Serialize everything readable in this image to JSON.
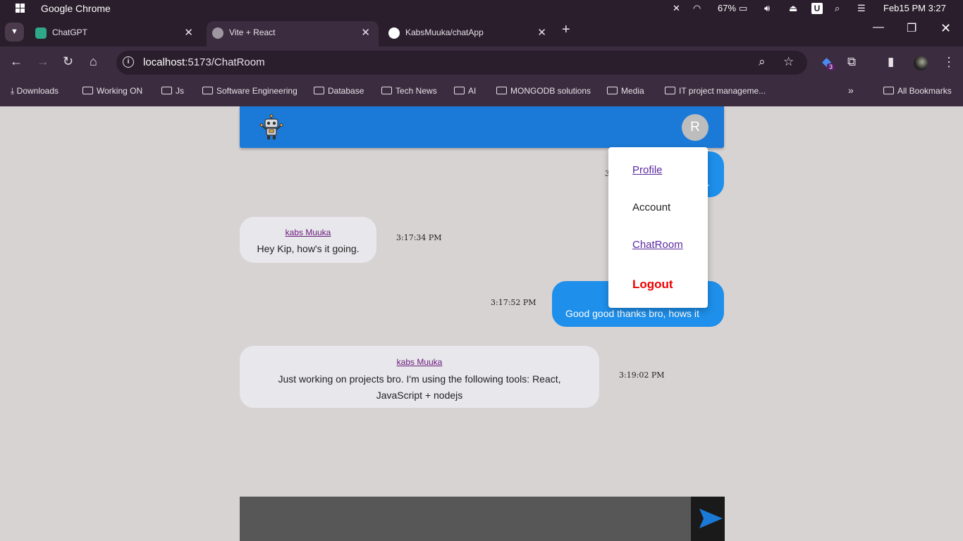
{
  "os": {
    "app_name": "Google Chrome",
    "battery": "67%",
    "datetime": "Feb15 PM 3:27",
    "user_badge": "U"
  },
  "tabs": [
    {
      "label": "ChatGPT"
    },
    {
      "label": "Vite + React"
    },
    {
      "label": "KabsMuuka/chatApp"
    }
  ],
  "address": {
    "host": "localhost",
    "path": ":5173/ChatRoom"
  },
  "extensions_badge": "3",
  "bookmarks": [
    "Downloads",
    "Working ON",
    "Js",
    "Software Engineering",
    "Database",
    "Tech News",
    "AI",
    "MONGODB solutions",
    "Media",
    "IT project manageme...",
    "All Bookmarks"
  ],
  "chat": {
    "avatar_letter": "R",
    "messages": [
      {
        "sender": "kabs Muuka",
        "text": "Hey Kip, how's it going.",
        "time": "3:17:34 PM"
      },
      {
        "text": "Good good thanks bro, hows it",
        "time": "3:17:52 PM"
      },
      {
        "sender": "kabs Muuka",
        "text": "Just working on projects bro. I'm using the following tools: React, JavaScript + nodejs",
        "time": "3:19:02 PM"
      }
    ],
    "hidden_partial": {
      "time_fragment": "3",
      "text_fragment": "."
    }
  },
  "menu": {
    "profile": "Profile",
    "account": "Account",
    "chatroom": "ChatRoom",
    "logout": "Logout"
  },
  "colors": {
    "header": "#1b7ad8",
    "outgoing_bubble": "#1e8fea",
    "incoming_bubble": "#e8e7ec",
    "logout": "#e00000"
  }
}
